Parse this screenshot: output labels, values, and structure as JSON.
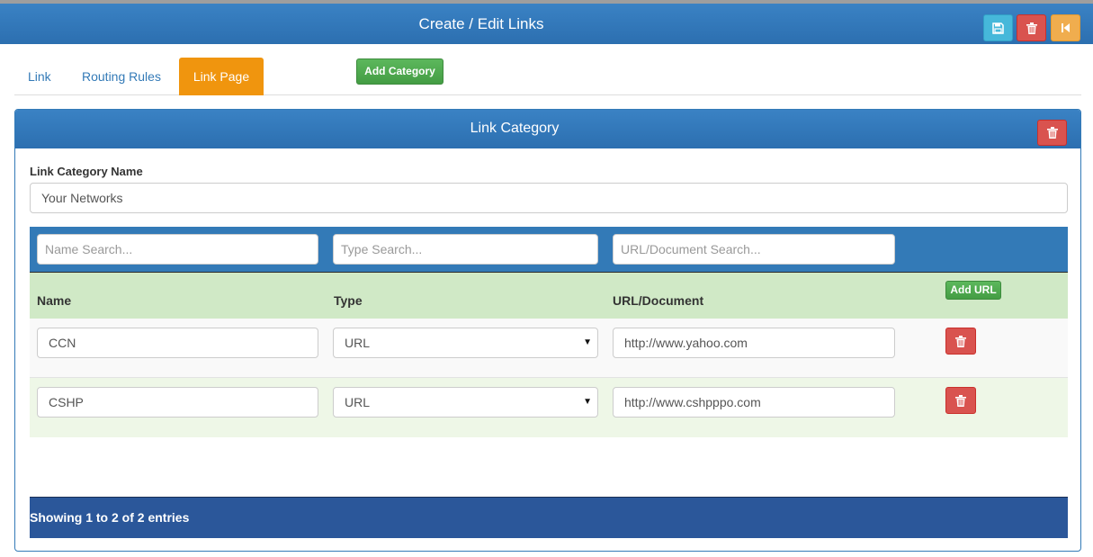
{
  "header": {
    "title": "Create / Edit Links",
    "buttons": {
      "save_icon": "floppy-icon",
      "delete_icon": "trash-icon",
      "back_icon": "skip-back-icon"
    }
  },
  "tabs": [
    {
      "label": "Link",
      "active": false
    },
    {
      "label": "Routing Rules",
      "active": false
    },
    {
      "label": "Link Page",
      "active": true
    }
  ],
  "add_category_label": "Add Category",
  "panel": {
    "title": "Link Category",
    "category_name_label": "Link Category Name",
    "category_name_value": "Your Networks",
    "search": {
      "name_placeholder": "Name Search...",
      "type_placeholder": "Type Search...",
      "url_placeholder": "URL/Document Search..."
    },
    "columns": {
      "name": "Name",
      "type": "Type",
      "url": "URL/Document"
    },
    "add_url_label": "Add URL",
    "rows": [
      {
        "name": "CCN",
        "type": "URL",
        "url": "http://www.yahoo.com"
      },
      {
        "name": "CSHP",
        "type": "URL",
        "url": "http://www.cshpppo.com"
      }
    ],
    "footer_info": "Showing 1 to 2 of 2 entries"
  },
  "colors": {
    "primary": "#337ab7",
    "active_tab": "#f0950e",
    "success": "#5cb85c",
    "danger": "#d9534f",
    "info": "#46b8da",
    "warning": "#f0ad4e",
    "header_row": "#d0e9c6",
    "footer": "#2b579a"
  }
}
